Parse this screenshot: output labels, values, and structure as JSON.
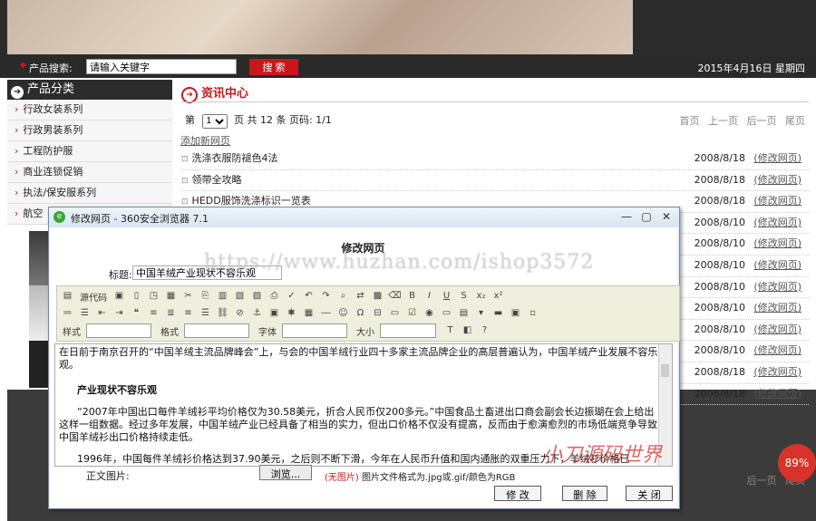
{
  "search": {
    "label": "产品搜索:",
    "value": "请输入关键字",
    "button": "搜 索"
  },
  "date": "2015年4月16日 星期四",
  "sidebar": {
    "heading": "产品分类",
    "items": [
      {
        "label": "行政女装系列"
      },
      {
        "label": "行政男装系列"
      },
      {
        "label": "工程防护服"
      },
      {
        "label": "商业连锁促销"
      },
      {
        "label": "执法/保安服系列"
      },
      {
        "label": "航空"
      }
    ]
  },
  "main": {
    "section_title": "资讯中心",
    "pager": {
      "prefix": "第",
      "page": "1",
      "suffix": "页 共 12 条 页码: 1/1"
    },
    "nav": "首页 上一页 后一页 尾页",
    "add_link": "添加新网页",
    "rows": [
      {
        "title": "洗涤衣服防褪色4法",
        "date": "2008/8/18",
        "edit": "(修改网页)"
      },
      {
        "title": "领带全攻略",
        "date": "2008/8/18",
        "edit": "(修改网页)"
      },
      {
        "title": "HEDD服饰洗涤标识一览表",
        "date": "2008/8/18",
        "edit": "(修改网页)"
      },
      {
        "title": "",
        "date": "2008/8/10",
        "edit": "(修改网页)"
      },
      {
        "title": "",
        "date": "2008/8/10",
        "edit": "(修改网页)"
      },
      {
        "title": "",
        "date": "2008/8/10",
        "edit": "(修改网页)"
      },
      {
        "title": "",
        "date": "2008/8/10",
        "edit": "(修改网页)"
      },
      {
        "title": "",
        "date": "2008/8/10",
        "edit": "(修改网页)"
      },
      {
        "title": "",
        "date": "2008/8/10",
        "edit": "(修改网页)"
      },
      {
        "title": "",
        "date": "2008/8/10",
        "edit": "(修改网页)"
      },
      {
        "title": "",
        "date": "2008/8/18",
        "edit": "(修改网页)"
      },
      {
        "title": "",
        "date": "2008/8/18",
        "edit": "(修改网页)"
      }
    ],
    "bottom_nav": "后一页 尾页"
  },
  "dialog": {
    "window_title": "修改网页 - 360安全浏览器 7.1",
    "heading": "修改网页",
    "title_label": "标题:",
    "title_value": "中国羊绒产业现状不容乐观",
    "toolbar": {
      "source_label": "源代码",
      "style_label": "样式",
      "format_label": "格式",
      "font_label": "字体",
      "size_label": "大小"
    },
    "content": {
      "p1": "在日前于南京召开的“中国羊绒主流品牌峰会”上，与会的中国羊绒行业四十多家主流品牌企业的高层普遍认为，中国羊绒产业发展不容乐观。",
      "h": "产业现状不容乐观",
      "p2": "“2007年中国出口每件羊绒衫平均价格仅为30.58美元，折合人民币仅200多元。”中国食品土畜进出口商会副会长边振瑚在会上给出这样一组数据。经过多年发展，中国羊绒产业已经具备了相当的实力，但出口价格不仅没有提高，反而由于愈演愈烈的市场低端竞争导致中国羊绒衫出口价格持续走低。",
      "p3": "1996年，中国每件羊绒衫价格达到37.90美元，之后则不断下滑，今年在人民币升值和国内通胀的双重压力下，羊绒衫价格已"
    },
    "image_label": "正文图片:",
    "browse": "浏览...",
    "hint_red": "(无图片)",
    "hint": "图片文件格式为.jpg或.gif/颜色为RGB",
    "buttons": {
      "edit": "修 改",
      "delete": "删 除",
      "close": "关 闭"
    }
  },
  "overlay": {
    "watermark": "https://www.huzhan.com/ishop3572",
    "watermark2": "小刀源码世界",
    "badge": "89%"
  }
}
